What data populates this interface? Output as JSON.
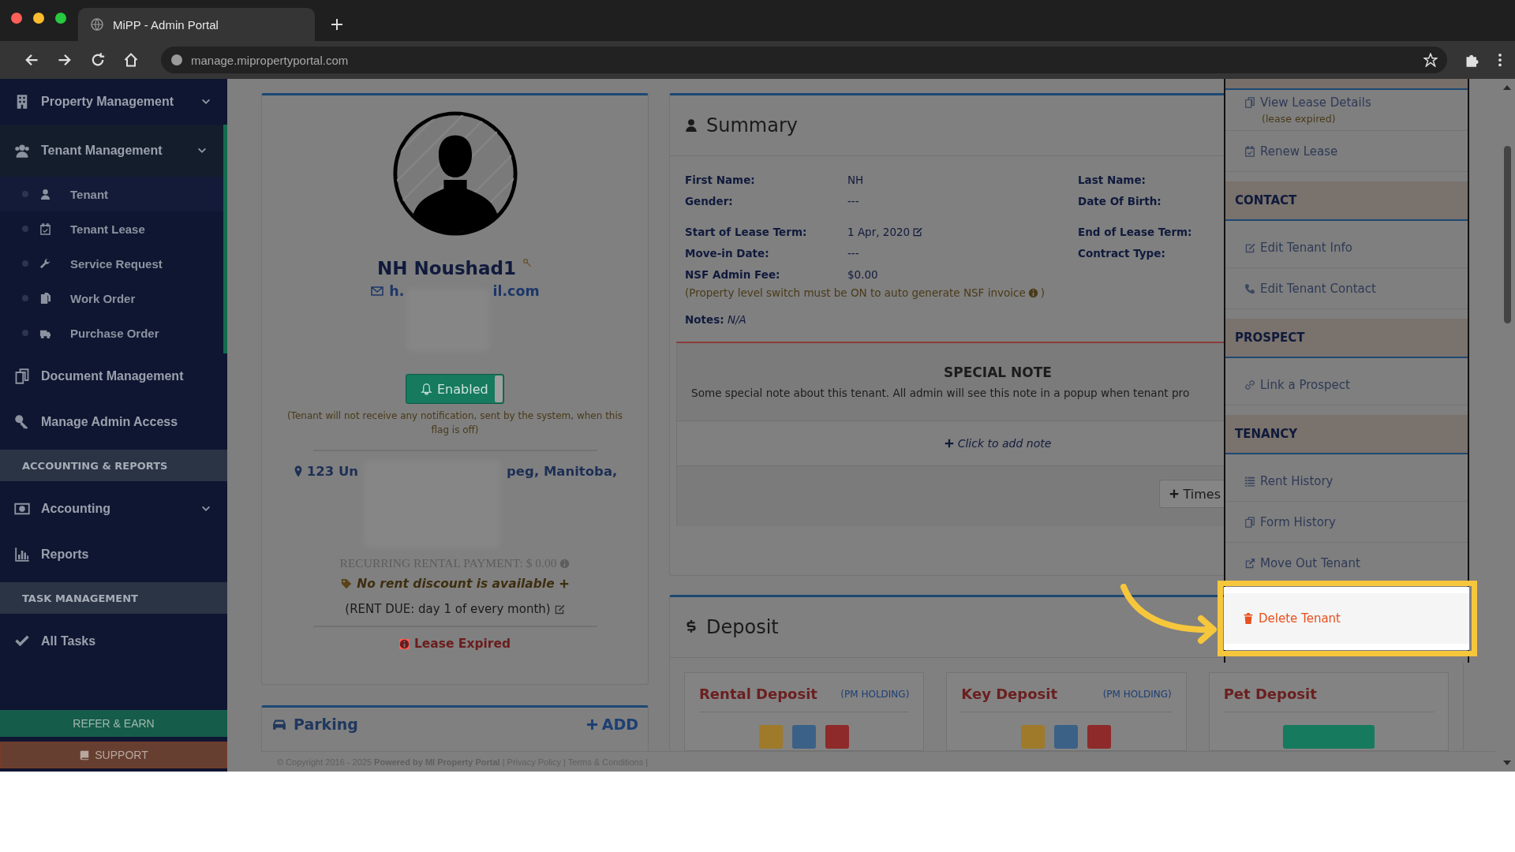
{
  "browser": {
    "tab_title": "MiPP - Admin Portal",
    "url": "manage.mipropertyportal.com"
  },
  "sidebar": {
    "items": [
      {
        "kind": "menu",
        "label": "Property Management",
        "expanded": false
      },
      {
        "kind": "menu",
        "label": "Tenant Management",
        "expanded": true,
        "children": [
          {
            "label": "Tenant",
            "selected": true
          },
          {
            "label": "Tenant Lease",
            "selected": false
          },
          {
            "label": "Service Request",
            "selected": false
          },
          {
            "label": "Work Order",
            "selected": false
          },
          {
            "label": "Purchase Order",
            "selected": false
          }
        ]
      },
      {
        "kind": "menu",
        "label": "Document Management"
      },
      {
        "kind": "menu",
        "label": "Manage Admin Access"
      },
      {
        "kind": "section",
        "label": "ACCOUNTING & REPORTS"
      },
      {
        "kind": "menu",
        "label": "Accounting",
        "expanded": false
      },
      {
        "kind": "menu",
        "label": "Reports"
      },
      {
        "kind": "section",
        "label": "TASK MANAGEMENT"
      },
      {
        "kind": "menu",
        "label": "All Tasks"
      }
    ],
    "refer_button": "REFER & EARN",
    "support_button": "SUPPORT"
  },
  "profile": {
    "name": "NH Noushad1",
    "email_start": "h.",
    "email_end": "il.com",
    "notification_toggle": {
      "label": "Enabled",
      "on": true
    },
    "notification_note": "(Tenant will not receive any notification, sent by the system, when this flag is off)",
    "address_start": "123 Un",
    "address_end": "peg, Manitoba,",
    "recurring_payment": "RECURRING RENTAL PAYMENT: $ 0.00",
    "discount": "No rent discount is available",
    "rent_due": "(RENT DUE: day 1 of every month)",
    "lease_status": "Lease Expired"
  },
  "parking": {
    "title": "Parking",
    "add_label": "ADD"
  },
  "summary": {
    "title": "Summary",
    "left_fields": [
      {
        "label": "First Name:",
        "value": "NH"
      },
      {
        "label": "Gender:",
        "value": "---"
      },
      {
        "label": "Start of Lease Term:",
        "value": "1 Apr, 2020",
        "editable": true
      },
      {
        "label": "Move-in Date:",
        "value": "---"
      },
      {
        "label": "NSF Admin Fee:",
        "value": "$0.00"
      }
    ],
    "right_fields": [
      {
        "label": "Last Name:"
      },
      {
        "label": "Date Of Birth:"
      },
      {
        "label": "End of Lease Term:"
      },
      {
        "label": "Contract Type:"
      }
    ],
    "nsf_note": "(Property level switch must be ON to auto generate NSF invoice",
    "nsf_note_end": ")",
    "notes": "**Notes:** *N/A*"
  },
  "special_note": {
    "title": "SPECIAL NOTE",
    "text": "Some special note about this tenant. All admin will see this note in a popup when tenant pro",
    "add_note": "Click to add note",
    "timesheet_button": "Times"
  },
  "deposit": {
    "title": "Deposit",
    "cards": [
      {
        "title": "Rental Deposit",
        "tag": "(PM HOLDING)",
        "kind": "actions"
      },
      {
        "title": "Key Deposit",
        "tag": "(PM HOLDING)",
        "kind": "actions"
      },
      {
        "title": "Pet Deposit",
        "kind": "add"
      }
    ]
  },
  "actions_menu": {
    "items": [
      {
        "kind": "item",
        "label": "View Lease Details",
        "note": "(lease expired)"
      },
      {
        "kind": "item",
        "label": "Renew Lease"
      },
      {
        "kind": "header",
        "label": "CONTACT"
      },
      {
        "kind": "item",
        "label": "Edit Tenant Info"
      },
      {
        "kind": "item",
        "label": "Edit Tenant Contact"
      },
      {
        "kind": "header",
        "label": "PROSPECT"
      },
      {
        "kind": "item",
        "label": "Link a Prospect"
      },
      {
        "kind": "header",
        "label": "TENANCY"
      },
      {
        "kind": "item",
        "label": "Rent History"
      },
      {
        "kind": "item",
        "label": "Form History"
      },
      {
        "kind": "item",
        "label": "Move Out Tenant"
      },
      {
        "kind": "danger",
        "label": "Delete Tenant",
        "highlighted": true
      }
    ]
  },
  "footer": "© Copyright 2016 - 2025 **Powered by MI Property Portal** | Privacy Policy | Terms & Conditions |"
}
